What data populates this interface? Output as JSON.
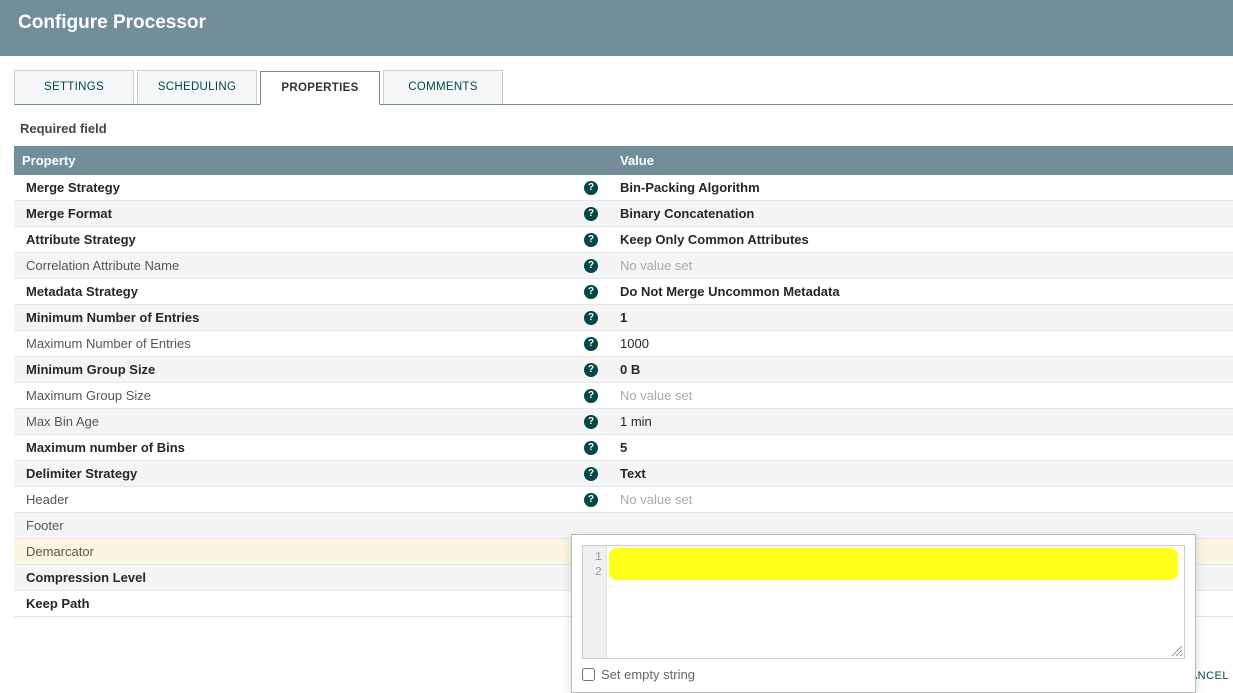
{
  "header": {
    "title": "Configure Processor"
  },
  "tabs": [
    {
      "label": "SETTINGS",
      "active": false
    },
    {
      "label": "SCHEDULING",
      "active": false
    },
    {
      "label": "PROPERTIES",
      "active": true
    },
    {
      "label": "COMMENTS",
      "active": false
    }
  ],
  "requiredLabel": "Required field",
  "columns": {
    "property": "Property",
    "value": "Value"
  },
  "properties": [
    {
      "name": "Merge Strategy",
      "bold": true,
      "help": true,
      "value": "Bin-Packing Algorithm",
      "valueBold": true
    },
    {
      "name": "Merge Format",
      "bold": true,
      "help": true,
      "value": "Binary Concatenation",
      "valueBold": true
    },
    {
      "name": "Attribute Strategy",
      "bold": true,
      "help": true,
      "value": "Keep Only Common Attributes",
      "valueBold": true
    },
    {
      "name": "Correlation Attribute Name",
      "bold": false,
      "help": true,
      "value": "No value set",
      "unset": true
    },
    {
      "name": "Metadata Strategy",
      "bold": true,
      "help": true,
      "value": "Do Not Merge Uncommon Metadata",
      "valueBold": true
    },
    {
      "name": "Minimum Number of Entries",
      "bold": true,
      "help": true,
      "value": "1",
      "valueBold": true
    },
    {
      "name": "Maximum Number of Entries",
      "bold": false,
      "help": true,
      "value": "1000"
    },
    {
      "name": "Minimum Group Size",
      "bold": true,
      "help": true,
      "value": "0 B",
      "valueBold": true
    },
    {
      "name": "Maximum Group Size",
      "bold": false,
      "help": true,
      "value": "No value set",
      "unset": true
    },
    {
      "name": "Max Bin Age",
      "bold": false,
      "help": true,
      "value": "1 min"
    },
    {
      "name": "Maximum number of Bins",
      "bold": true,
      "help": true,
      "value": "5",
      "valueBold": true
    },
    {
      "name": "Delimiter Strategy",
      "bold": true,
      "help": true,
      "value": "Text",
      "valueBold": true
    },
    {
      "name": "Header",
      "bold": false,
      "help": true,
      "value": "No value set",
      "unset": true
    },
    {
      "name": "Footer",
      "bold": false,
      "help": false,
      "value": ""
    },
    {
      "name": "Demarcator",
      "bold": false,
      "help": false,
      "value": "",
      "editing": true
    },
    {
      "name": "Compression Level",
      "bold": true,
      "help": false,
      "value": ""
    },
    {
      "name": "Keep Path",
      "bold": true,
      "help": false,
      "value": ""
    }
  ],
  "editor": {
    "gutterLines": [
      "1",
      "2"
    ],
    "content": "",
    "setEmptyLabel": "Set empty string"
  },
  "footer": {
    "cancel": "ANCEL"
  }
}
